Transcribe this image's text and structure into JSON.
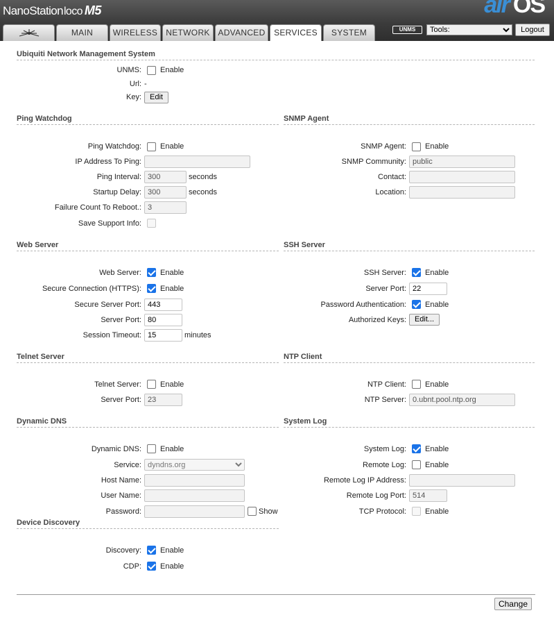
{
  "header": {
    "brand_name": "NanoStation",
    "brand_model": "loco",
    "brand_gen": "M5",
    "logo_air": "air",
    "logo_os": "OS",
    "tabs": [
      {
        "label": "",
        "icon": "ubiquiti-logo-icon"
      },
      {
        "label": "MAIN"
      },
      {
        "label": "WIRELESS"
      },
      {
        "label": "NETWORK"
      },
      {
        "label": "ADVANCED"
      },
      {
        "label": "SERVICES"
      },
      {
        "label": "SYSTEM"
      }
    ],
    "active_tab": "SERVICES",
    "unms_badge": "UNMS",
    "tools_value": "Tools:",
    "logout_label": "Logout"
  },
  "unms": {
    "title": "Ubiquiti Network Management System",
    "unms_label": "UNMS:",
    "unms_enable": "Enable",
    "unms_checked": false,
    "url_label": "Url:",
    "url_value": "-",
    "key_label": "Key:",
    "key_button": "Edit"
  },
  "ping": {
    "title": "Ping Watchdog",
    "watchdog_label": "Ping Watchdog:",
    "watchdog_enable": "Enable",
    "ip_label": "IP Address To Ping:",
    "ip_value": "",
    "interval_label": "Ping Interval:",
    "interval_value": "300",
    "interval_unit": "seconds",
    "startup_label": "Startup Delay:",
    "startup_value": "300",
    "startup_unit": "seconds",
    "failure_label": "Failure Count To Reboot.:",
    "failure_value": "3",
    "support_label": "Save Support Info:"
  },
  "snmp": {
    "title": "SNMP Agent",
    "agent_label": "SNMP Agent:",
    "agent_enable": "Enable",
    "community_label": "SNMP Community:",
    "community_value": "public",
    "contact_label": "Contact:",
    "contact_value": "",
    "location_label": "Location:",
    "location_value": ""
  },
  "web": {
    "title": "Web Server",
    "server_label": "Web Server:",
    "server_enable": "Enable",
    "https_label": "Secure Connection (HTTPS):",
    "https_enable": "Enable",
    "secure_port_label": "Secure Server Port:",
    "secure_port_value": "443",
    "port_label": "Server Port:",
    "port_value": "80",
    "timeout_label": "Session Timeout:",
    "timeout_value": "15",
    "timeout_unit": "minutes"
  },
  "ssh": {
    "title": "SSH Server",
    "server_label": "SSH Server:",
    "server_enable": "Enable",
    "port_label": "Server Port:",
    "port_value": "22",
    "password_auth_label": "Password Authentication:",
    "password_auth_enable": "Enable",
    "keys_label": "Authorized Keys:",
    "keys_button": "Edit..."
  },
  "telnet": {
    "title": "Telnet Server",
    "server_label": "Telnet Server:",
    "server_enable": "Enable",
    "port_label": "Server Port:",
    "port_value": "23"
  },
  "ntp": {
    "title": "NTP Client",
    "client_label": "NTP Client:",
    "client_enable": "Enable",
    "server_label": "NTP Server:",
    "server_value": "0.ubnt.pool.ntp.org"
  },
  "ddns": {
    "title": "Dynamic DNS",
    "ddns_label": "Dynamic DNS:",
    "ddns_enable": "Enable",
    "service_label": "Service:",
    "service_value": "dyndns.org",
    "host_label": "Host Name:",
    "host_value": "",
    "user_label": "User Name:",
    "user_value": "",
    "password_label": "Password:",
    "password_value": "",
    "show_label": "Show"
  },
  "syslog": {
    "title": "System Log",
    "log_label": "System Log:",
    "log_enable": "Enable",
    "remote_label": "Remote Log:",
    "remote_enable": "Enable",
    "remote_ip_label": "Remote Log IP Address:",
    "remote_ip_value": "",
    "remote_port_label": "Remote Log Port:",
    "remote_port_value": "514",
    "tcp_label": "TCP Protocol:",
    "tcp_enable": "Enable"
  },
  "discovery": {
    "title": "Device Discovery",
    "discovery_label": "Discovery:",
    "discovery_enable": "Enable",
    "cdp_label": "CDP:",
    "cdp_enable": "Enable"
  },
  "footer": {
    "change_button": "Change"
  },
  "colors": {
    "header_bg": "#3c3c3c",
    "checkbox_checked": "#1a73e8",
    "section_title": "#454545",
    "logo_blue": "#3a8fd6"
  }
}
